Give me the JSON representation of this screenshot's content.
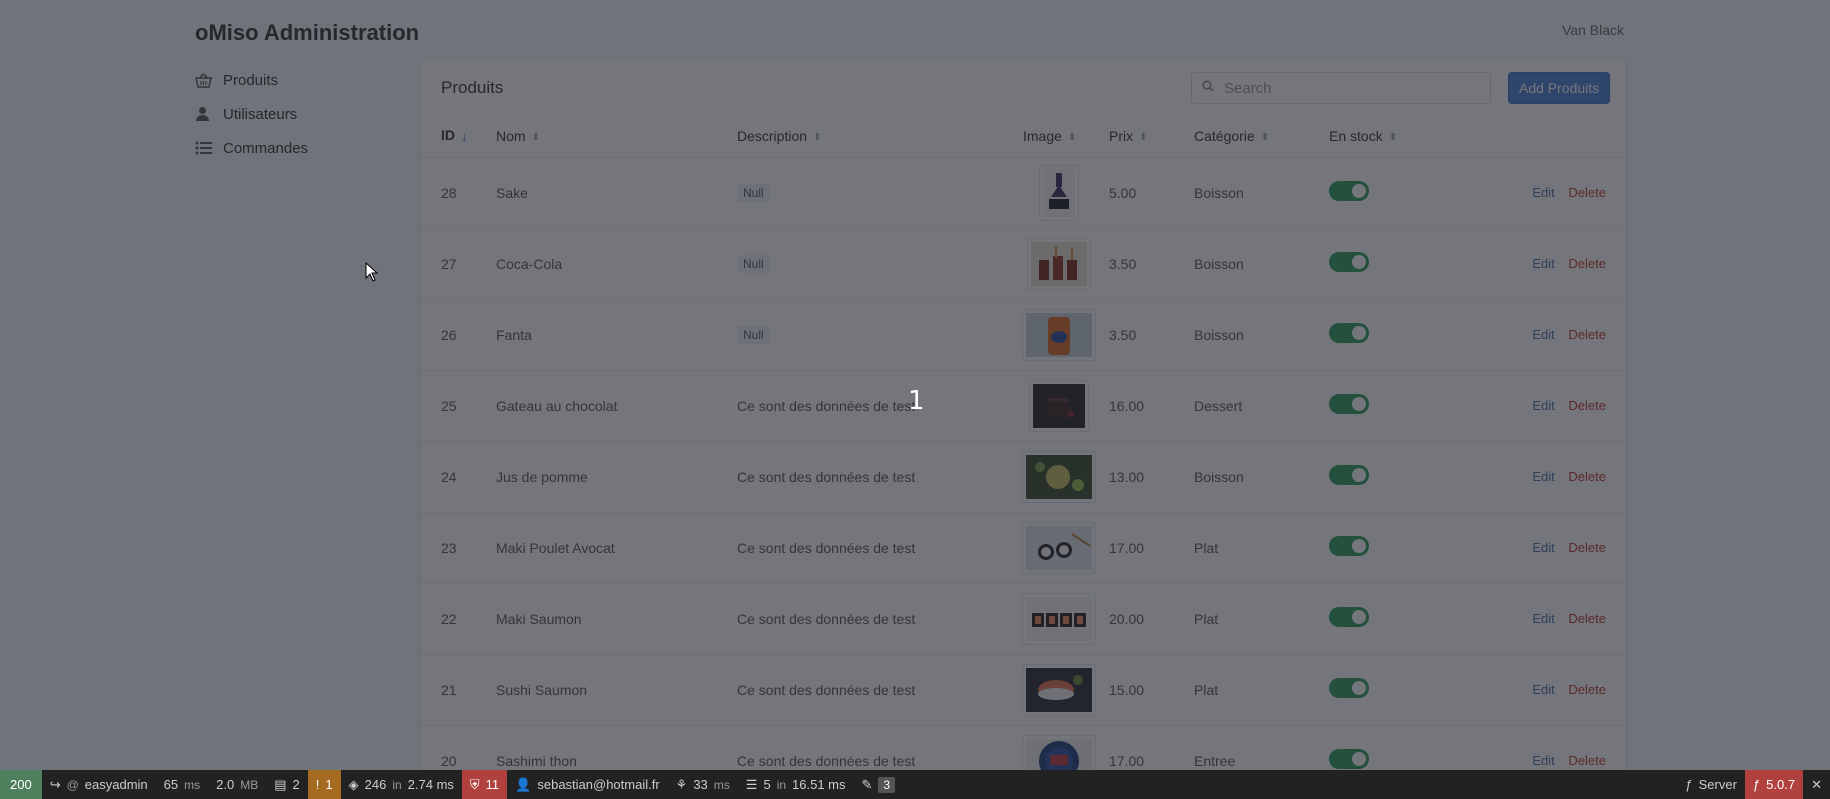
{
  "brand": "oMiso Administration",
  "user_menu": "Van Black",
  "sidebar": {
    "items": [
      {
        "label": "Produits",
        "icon": "basket-icon"
      },
      {
        "label": "Utilisateurs",
        "icon": "user-icon"
      },
      {
        "label": "Commandes",
        "icon": "list-icon"
      }
    ]
  },
  "panel": {
    "title": "Produits",
    "search_placeholder": "Search",
    "add_label": "Add Produits"
  },
  "table": {
    "columns": [
      "ID",
      "Nom",
      "Description",
      "Image",
      "Prix",
      "Catégorie",
      "En stock"
    ],
    "sorted_column": "ID",
    "rows": [
      {
        "id": "28",
        "nom": "Sake",
        "description": "Null",
        "null": true,
        "prix": "5.00",
        "categorie": "Boisson",
        "image": "sake-bottle"
      },
      {
        "id": "27",
        "nom": "Coca-Cola",
        "description": "Null",
        "null": true,
        "prix": "3.50",
        "categorie": "Boisson",
        "image": "coca-cola-glasses"
      },
      {
        "id": "26",
        "nom": "Fanta",
        "description": "Null",
        "null": true,
        "prix": "3.50",
        "categorie": "Boisson",
        "image": "fanta-can"
      },
      {
        "id": "25",
        "nom": "Gateau au chocolat",
        "description": "Ce sont des données de test",
        "null": false,
        "prix": "16.00",
        "categorie": "Dessert",
        "image": "chocolate-cake"
      },
      {
        "id": "24",
        "nom": "Jus de pomme",
        "description": "Ce sont des données de test",
        "null": false,
        "prix": "13.00",
        "categorie": "Boisson",
        "image": "apple-juice"
      },
      {
        "id": "23",
        "nom": "Maki Poulet Avocat",
        "description": "Ce sont des données de test",
        "null": false,
        "prix": "17.00",
        "categorie": "Plat",
        "image": "maki-chicken"
      },
      {
        "id": "22",
        "nom": "Maki Saumon",
        "description": "Ce sont des données de test",
        "null": false,
        "prix": "20.00",
        "categorie": "Plat",
        "image": "maki-salmon"
      },
      {
        "id": "21",
        "nom": "Sushi Saumon",
        "description": "Ce sont des données de test",
        "null": false,
        "prix": "15.00",
        "categorie": "Plat",
        "image": "sushi-salmon"
      },
      {
        "id": "20",
        "nom": "Sashimi thon",
        "description": "Ce sont des données de test",
        "null": false,
        "prix": "17.00",
        "categorie": "Entree",
        "image": "sashimi-tuna"
      }
    ],
    "edit_label": "Edit",
    "delete_label": "Delete"
  },
  "loading_indicator": "1",
  "debug_toolbar": {
    "status": "200",
    "route": "easyadmin",
    "route_prefix": "@",
    "time": "65",
    "time_unit": "ms",
    "memory": "2.0",
    "memory_unit": "MB",
    "forms": "2",
    "logs": "1",
    "cache_calls": "246",
    "cache_in": "in",
    "cache_time": "2.74 ms",
    "security_errors": "11",
    "user": "sebastian@hotmail.fr",
    "twig_time": "33",
    "twig_unit": "ms",
    "db_queries": "5",
    "db_in": "in",
    "db_time": "16.51 ms",
    "translations": "3",
    "server_label": "Server",
    "version": "5.0.7"
  },
  "colors": {
    "accent": "#4a7fd6",
    "toggle_on": "#2e9d5c",
    "delete": "#c0392b",
    "overlay": "#1e222c"
  }
}
